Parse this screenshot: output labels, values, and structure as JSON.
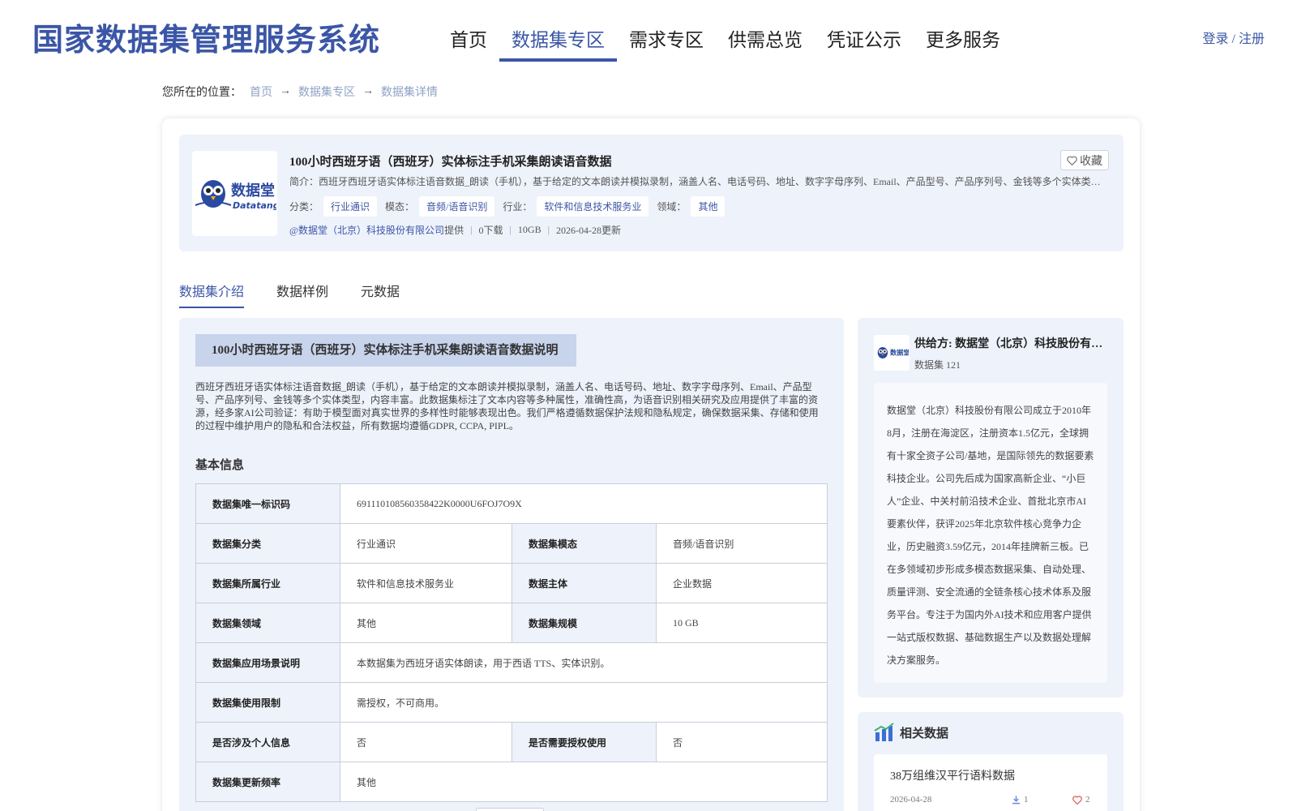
{
  "header": {
    "logo": "国家数据集管理服务系统",
    "nav": [
      "首页",
      "数据集专区",
      "需求专区",
      "供需总览",
      "凭证公示",
      "更多服务"
    ],
    "login": "登录 / 注册"
  },
  "breadcrumb": {
    "label": "您所在的位置：",
    "items": [
      "首页",
      "数据集专区",
      "数据集详情"
    ]
  },
  "dataset": {
    "logo_text": "数据堂",
    "logo_sub": "Datatang",
    "title": "100小时西班牙语（西班牙）实体标注手机采集朗读语音数据",
    "favorite": "收藏",
    "summary": "简介：西班牙西班牙语实体标注语音数据_朗读（手机），基于给定的文本朗读并模拟录制，涵盖人名、电话号码、地址、数字字母序列、Email、产品型号、产品序列号、金钱等多个实体类型，内容丰富。",
    "tags": [
      {
        "label": "分类：",
        "value": "行业通识"
      },
      {
        "label": "模态：",
        "value": "音频/语音识别"
      },
      {
        "label": "行业：",
        "value": "软件和信息技术服务业"
      },
      {
        "label": "领域：",
        "value": "其他"
      }
    ],
    "provider_link": "@数据堂（北京）科技股份有限公司",
    "provided": "提供",
    "downloads": "0下载",
    "size": "10GB",
    "updated": "2026-04-28更新"
  },
  "tabs": [
    "数据集介绍",
    "数据样例",
    "元数据"
  ],
  "intro": {
    "title": "100小时西班牙语（西班牙）实体标注手机采集朗读语音数据说明",
    "text": "西班牙西班牙语实体标注语音数据_朗读（手机），基于给定的文本朗读并模拟录制，涵盖人名、电话号码、地址、数字字母序列、Email、产品型号、产品序列号、金钱等多个实体类型，内容丰富。此数据集标注了文本内容等多种属性，准确性高，为语音识别相关研究及应用提供了丰富的资源，经多家AI公司验证：有助于模型面对真实世界的多样性时能够表现出色。我们严格遵循数据保护法规和隐私规定，确保数据采集、存储和使用的过程中维护用户的隐私和合法权益，所有数据均遵循GDPR, CCPA, PIPL。",
    "basic_title": "基本信息"
  },
  "info": {
    "uid_k": "数据集唯一标识码",
    "uid_v": "691110108560358422K0000U6FOJ7O9X",
    "cat_k": "数据集分类",
    "cat_v": "行业通识",
    "mod_k": "数据集模态",
    "mod_v": "音频/语音识别",
    "ind_k": "数据集所属行业",
    "ind_v": "软件和信息技术服务业",
    "subj_k": "数据主体",
    "subj_v": "企业数据",
    "dom_k": "数据集领域",
    "dom_v": "其他",
    "scale_k": "数据集规模",
    "scale_v": "10 GB",
    "scene_k": "数据集应用场景说明",
    "scene_v": "本数据集为西班牙语实体朗读，用于西语 TTS、实体识别。",
    "limit_k": "数据集使用限制",
    "limit_v": "需授权，不可商用。",
    "pii_k": "是否涉及个人信息",
    "pii_v": "否",
    "auth_k": "是否需要授权使用",
    "auth_v": "否",
    "freq_k": "数据集更新频率",
    "freq_v": "其他"
  },
  "provider": {
    "name": "供给方: 数据堂（北京）科技股份有限公司",
    "count": "数据集 121",
    "desc": "数据堂（北京）科技股份有限公司成立于2010年8月，注册在海淀区，注册资本1.5亿元，全球拥有十家全资子公司/基地，是国际领先的数据要素科技企业。公司先后成为国家高新企业、“小巨人”企业、中关村前沿技术企业、首批北京市AI要素伙伴，获评2025年北京软件核心竞争力企业，历史融资3.59亿元，2014年挂牌新三板。已在多领域初步形成多模态数据采集、自动处理、质量评测、安全流通的全链条核心技术体系及服务平台。专注于为国内外AI技术和应用客户提供一站式版权数据、基础数据生产以及数据处理解决方案服务。"
  },
  "related": {
    "title": "相关数据",
    "items": [
      {
        "title": "38万组维汉平行语料数据",
        "date": "2026-04-28",
        "downloads": "1",
        "likes": "2"
      }
    ]
  },
  "colors": {
    "accent": "#3b56a6",
    "panel": "#eef2fb",
    "muted_link": "#8fa1c6"
  },
  "icons": [
    "arrow-right-icon",
    "heart-icon",
    "download-icon",
    "chart-icon",
    "owl-logo-icon"
  ]
}
